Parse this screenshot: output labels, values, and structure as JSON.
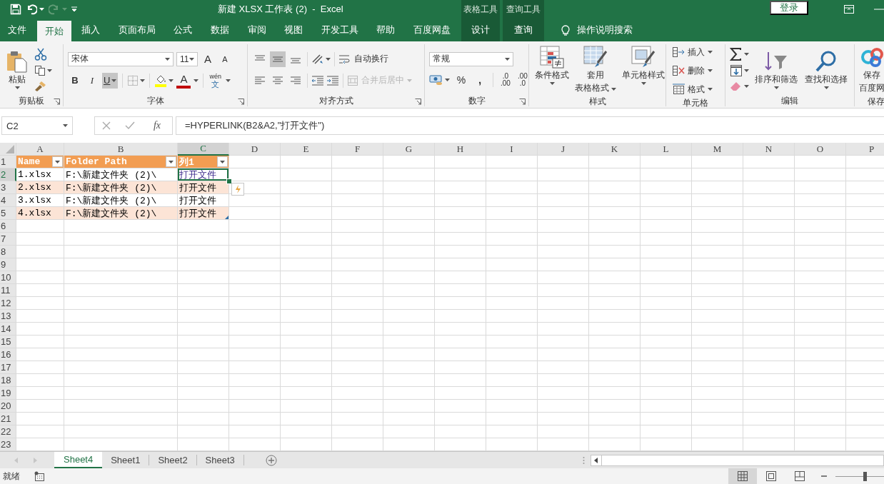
{
  "title_bar": {
    "title": "新建 XLSX 工作表 (2)  -  Excel",
    "context_groups": [
      {
        "label": "表格工具"
      },
      {
        "label": "查询工具"
      }
    ],
    "sign_in": "登录"
  },
  "ribbon_tabs": [
    {
      "label": "文件",
      "selected": false,
      "contextual": false
    },
    {
      "label": "开始",
      "selected": true,
      "contextual": false
    },
    {
      "label": "插入",
      "selected": false,
      "contextual": false
    },
    {
      "label": "页面布局",
      "selected": false,
      "contextual": false
    },
    {
      "label": "公式",
      "selected": false,
      "contextual": false
    },
    {
      "label": "数据",
      "selected": false,
      "contextual": false
    },
    {
      "label": "审阅",
      "selected": false,
      "contextual": false
    },
    {
      "label": "视图",
      "selected": false,
      "contextual": false
    },
    {
      "label": "开发工具",
      "selected": false,
      "contextual": false
    },
    {
      "label": "帮助",
      "selected": false,
      "contextual": false
    },
    {
      "label": "百度网盘",
      "selected": false,
      "contextual": false
    },
    {
      "label": "设计",
      "selected": false,
      "contextual": true
    },
    {
      "label": "查询",
      "selected": false,
      "contextual": true
    }
  ],
  "tell_me": "操作说明搜索",
  "ribbon_groups": [
    {
      "kind": "clipboard",
      "label": "剪贴板",
      "launcher": true,
      "paste": "粘贴"
    },
    {
      "kind": "font",
      "label": "字体",
      "launcher": true,
      "font_name": "宋体",
      "font_size": "11",
      "grow": "A",
      "shrink": "A",
      "styles": [
        {
          "label": "B",
          "selected": false
        },
        {
          "label": "I",
          "selected": false
        },
        {
          "label": "U",
          "selected": true
        }
      ],
      "font_color": "A",
      "phonetic": {
        "top": "wén",
        "bottom": "文"
      }
    },
    {
      "kind": "alignment",
      "label": "对齐方式",
      "launcher": true,
      "vertical_align": [
        {
          "selected": false
        },
        {
          "selected": true
        },
        {
          "selected": false
        }
      ],
      "wrap_text": {
        "label": "自动换行",
        "disabled": false
      },
      "merge": {
        "label": "合并后居中",
        "disabled": true
      }
    },
    {
      "kind": "number",
      "label": "数字",
      "launcher": true,
      "format": "常规",
      "percent": "%",
      "comma": ",",
      "decimals": [
        {
          "top": ".0",
          "bottom": ".00"
        },
        {
          "top": ".00",
          "bottom": ".0"
        }
      ]
    },
    {
      "kind": "styles",
      "label": "样式",
      "launcher": false,
      "buttons": [
        {
          "lines": [
            "条件格式"
          ]
        },
        {
          "lines": [
            "套用",
            "表格格式"
          ]
        },
        {
          "lines": [
            "单元格样式"
          ]
        }
      ]
    },
    {
      "kind": "cells",
      "label": "单元格",
      "launcher": false,
      "buttons": [
        {
          "label": "插入"
        },
        {
          "label": "删除"
        },
        {
          "label": "格式"
        }
      ]
    },
    {
      "kind": "editing",
      "label": "编辑",
      "launcher": false,
      "buttons": [
        {
          "label": "排序和筛选"
        },
        {
          "label": "查找和选择"
        }
      ]
    },
    {
      "kind": "save",
      "label": "保存",
      "launcher": false,
      "lines": [
        "保存",
        "百度网"
      ]
    }
  ],
  "formula_bar": {
    "name_box": "C2",
    "fx": "fx",
    "formula": "=HYPERLINK(B2&A2,\"打开文件\")"
  },
  "sheet": {
    "columns": [
      {
        "label": "A",
        "selected": false
      },
      {
        "label": "B",
        "selected": false
      },
      {
        "label": "C",
        "selected": true
      },
      {
        "label": "D",
        "selected": false
      },
      {
        "label": "E",
        "selected": false
      },
      {
        "label": "F",
        "selected": false
      },
      {
        "label": "G",
        "selected": false
      },
      {
        "label": "H",
        "selected": false
      },
      {
        "label": "I",
        "selected": false
      },
      {
        "label": "J",
        "selected": false
      },
      {
        "label": "K",
        "selected": false
      },
      {
        "label": "L",
        "selected": false
      },
      {
        "label": "M",
        "selected": false
      },
      {
        "label": "N",
        "selected": false
      },
      {
        "label": "O",
        "selected": false
      },
      {
        "label": "P",
        "selected": false
      }
    ],
    "rows": [
      {
        "label": "1",
        "selected": false
      },
      {
        "label": "2",
        "selected": true
      },
      {
        "label": "3",
        "selected": false
      },
      {
        "label": "4",
        "selected": false
      },
      {
        "label": "5",
        "selected": false
      },
      {
        "label": "6",
        "selected": false
      },
      {
        "label": "7",
        "selected": false
      },
      {
        "label": "8",
        "selected": false
      },
      {
        "label": "9",
        "selected": false
      },
      {
        "label": "10",
        "selected": false
      },
      {
        "label": "11",
        "selected": false
      },
      {
        "label": "12",
        "selected": false
      },
      {
        "label": "13",
        "selected": false
      },
      {
        "label": "14",
        "selected": false
      },
      {
        "label": "15",
        "selected": false
      },
      {
        "label": "16",
        "selected": false
      },
      {
        "label": "17",
        "selected": false
      },
      {
        "label": "18",
        "selected": false
      },
      {
        "label": "19",
        "selected": false
      },
      {
        "label": "20",
        "selected": false
      },
      {
        "label": "21",
        "selected": false
      },
      {
        "label": "22",
        "selected": false
      },
      {
        "label": "23",
        "selected": false
      }
    ],
    "table": {
      "headers": [
        "Name",
        "Folder Path",
        "列1"
      ],
      "rows": [
        {
          "name": "1.xlsx",
          "path": "F:\\新建文件夹 (2)\\",
          "link": {
            "text": "打开文件",
            "active": true,
            "visited": true
          }
        },
        {
          "name": "2.xlsx",
          "path": "F:\\新建文件夹 (2)\\",
          "link": {
            "text": "打开文件",
            "active": false,
            "visited": false
          }
        },
        {
          "name": "3.xlsx",
          "path": "F:\\新建文件夹 (2)\\",
          "link": {
            "text": "打开文件",
            "active": false,
            "visited": false
          }
        },
        {
          "name": "4.xlsx",
          "path": "F:\\新建文件夹 (2)\\",
          "link": {
            "text": "打开文件",
            "active": false,
            "visited": false
          }
        }
      ]
    }
  },
  "sheet_tabs": [
    {
      "label": "Sheet4",
      "selected": true
    },
    {
      "label": "Sheet1",
      "selected": false
    },
    {
      "label": "Sheet2",
      "selected": false
    },
    {
      "label": "Sheet3",
      "selected": false
    }
  ],
  "status_bar": {
    "text": "就绪",
    "views": [
      {
        "selected": true
      },
      {
        "selected": false
      },
      {
        "selected": false
      }
    ],
    "zoom": {
      "level": 0.6
    }
  }
}
